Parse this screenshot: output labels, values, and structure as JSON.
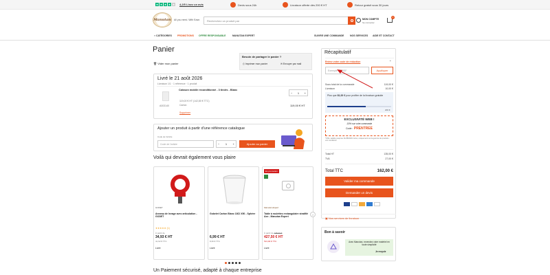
{
  "topbar": {
    "rating": "4,2/5 Lisez un avis",
    "devis": "Devis sous 24h",
    "livraison": "Livraison offerte dès 200 € HT",
    "retour": "Retour gratuit sous 30 jours"
  },
  "header": {
    "logo_text": "Manutan",
    "tagline": "All you need. With Ease.",
    "search_placeholder": "Recherchez un produit par",
    "account_label": "MON COMPTE",
    "account_sub": "Se connecter",
    "cart_count": "1"
  },
  "nav": {
    "categories": "CATÉGORIES",
    "promotions": "PROMOTIONS",
    "responsable": "OFFRE RESPONSABLE",
    "expert": "MANUTAN EXPERT",
    "suivre": "SUIVRE UNE COMMANDE",
    "services": "NOS SERVICES",
    "aide": "AIDE ET CONTACT"
  },
  "cart": {
    "title": "Panier",
    "vider": "Vider mon panier",
    "share_title": "Besoin de partager le panier ?",
    "imprimer": "Imprimer mon panier",
    "envoyer": "Envoyer par mail",
    "delivery": "Livré le 21 août 2026",
    "delivery_sub": "Livraison 1/1 · 1 référence · 1 produit",
    "product_name": "Caisson mobile reconditionné - 3 tiroirs - Blanc",
    "product_ref": "A003140",
    "unit_price": "119,00 € HT (142,80 € TTC)",
    "cond": "Carton",
    "line_total": "119,00 € HT",
    "qty": "1",
    "supprimer": "Supprimer"
  },
  "quickadd": {
    "title": "Ajouter un produit à partir d'une référence catalogue",
    "label": "Code de l'article",
    "placeholder": "Code de l'article",
    "qty": "1",
    "button": "Ajouter au panier"
  },
  "reco": {
    "title": "Voilà qui devrait également vous plaire",
    "items": [
      {
        "brand": "GODET",
        "name": "Anneau de levage avec articulation - GODET",
        "rating": "★★★★★ (1)",
        "price_from": "À partir de",
        "price": "34,93 € HT",
        "ttc": "41,92 € TTC",
        "cta": "Livré"
      },
      {
        "brand": "",
        "name": "Gobelet Carton Blanc 18Cl X50 - Sphère",
        "rating": "",
        "price_from": "",
        "price": "6,99 € HT",
        "ttc": "8,39 € TTC",
        "cta": "Livré"
      },
      {
        "brand": "Manutan Expert",
        "badge": "En promotion",
        "name": "Table à roulettes rectangulaire stratifié Axe - Manutan Expert",
        "rating": "",
        "price_from": "À partir de",
        "old_price": "475,00 €",
        "price": "427,50 € HT",
        "ttc": "513,00 € TTC",
        "cta": "Livré"
      }
    ]
  },
  "payment_title": "Un Paiement sécurisé, adapté à chaque entreprise",
  "summary": {
    "title": "Récapitulatif",
    "promo_link": "Entrez votre code de réduction",
    "promo_placeholder": "Exemple : 38REF",
    "apply": "Appliquer",
    "subtotal_label": "Sous total de la commande",
    "subtotal": "119,00 €",
    "livraison_label": "Livraison",
    "livraison": "10,00 €",
    "free_msg_1": "Plus que ",
    "free_amount": "81,00 €",
    "free_msg_2": " pour profiter de la livraison gratuite",
    "progress_end": "200 €",
    "progress": 0.6,
    "excl_title": "EXCLUSIVITÉ WEB !",
    "excl_sub": "-15% sur votre commande",
    "code_label": "Code :",
    "code": "PRENTREE",
    "small_text": "*Offre valable jusqu'au 31/08/2026 inclus, uniquement sur la gamme de produits... voir conditions",
    "total_ht_label": "Total HT",
    "total_ht": "135,00 €",
    "tva_label": "TVA",
    "tva": "27,00 €",
    "total_ttc_label": "Total TTC",
    "total_ttc": "162,00 €",
    "valider": "Valider ma commande",
    "devis": "Demander un devis",
    "services": "Nos services de livraison"
  },
  "bon": {
    "title": "Bon à savoir",
    "text": "Avec Manutan, revendez votre matériel en toute simplicité",
    "link": "Je recycle"
  }
}
